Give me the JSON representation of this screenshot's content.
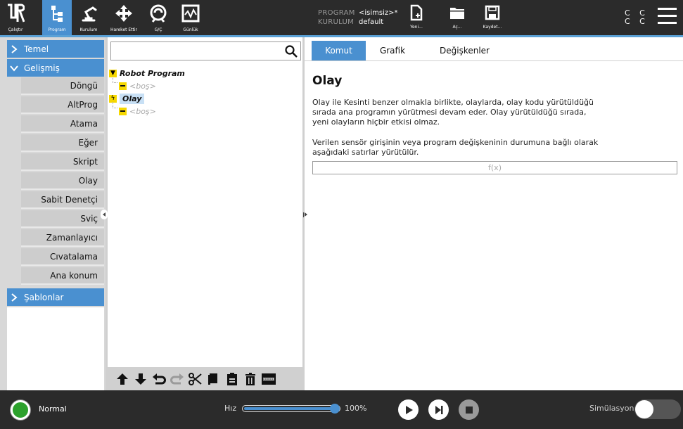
{
  "topbar": {
    "nav": [
      {
        "label": "Çalıştır",
        "icon": "ur-logo-icon"
      },
      {
        "label": "Program",
        "icon": "program-tree-icon"
      },
      {
        "label": "Kurulum",
        "icon": "robot-arm-icon"
      },
      {
        "label": "Hareket Ettir",
        "icon": "move-arrows-icon"
      },
      {
        "label": "G/Ç",
        "icon": "io-icon"
      },
      {
        "label": "Günlük",
        "icon": "log-chart-icon"
      }
    ],
    "program_key": "PROGRAM",
    "program_value": "<isimsiz>*",
    "installation_key": "KURULUM",
    "installation_value": "default",
    "file_buttons": [
      {
        "label": "Yeni...",
        "icon": "new-file-icon"
      },
      {
        "label": "Aç...",
        "icon": "open-folder-icon"
      },
      {
        "label": "Kaydet...",
        "icon": "save-icon"
      }
    ],
    "cc_row1": "C C",
    "cc_row2": "C C"
  },
  "left": {
    "categories": {
      "temel": "Temel",
      "gelismis": "Gelişmiş",
      "sablonlar": "Şablonlar"
    },
    "nodes": [
      "Döngü",
      "AltProg",
      "Atama",
      "Eğer",
      "Skript",
      "Olay",
      "Sabit Denetçi",
      "Sviç",
      "Zamanlayıcı",
      "Cıvatalama",
      "Ana konum"
    ]
  },
  "tree": {
    "search_placeholder": "",
    "root": "Robot Program",
    "empty1": "<boş>",
    "event": "Olay",
    "empty2": "<boş>"
  },
  "content": {
    "tabs": [
      "Komut",
      "Grafik",
      "Değişkenler"
    ],
    "active_tab": "Komut",
    "title": "Olay",
    "para1": "Olay ile Kesinti benzer olmakla birlikte, olaylarda, olay kodu yürütüldüğü sırada ana programın yürütmesi devam eder. Olay yürütüldüğü sırada, yeni olayların hiçbir etkisi olmaz.",
    "para2": "Verilen sensör girişinin veya program değişkeninin durumuna bağlı olarak aşağıdaki satırlar yürütülür.",
    "expression_placeholder": "f(x)"
  },
  "bottombar": {
    "status": "Normal",
    "status_color": "#2ca12c",
    "speed_label": "Hız",
    "speed_value": "100%",
    "speed_fraction": 1.0,
    "simulation_label": "Simülasyon",
    "simulation_on": false
  },
  "colors": {
    "accent": "#4a90d0",
    "topbar": "#2b2b2b",
    "marker_yellow": "#f6d800"
  }
}
